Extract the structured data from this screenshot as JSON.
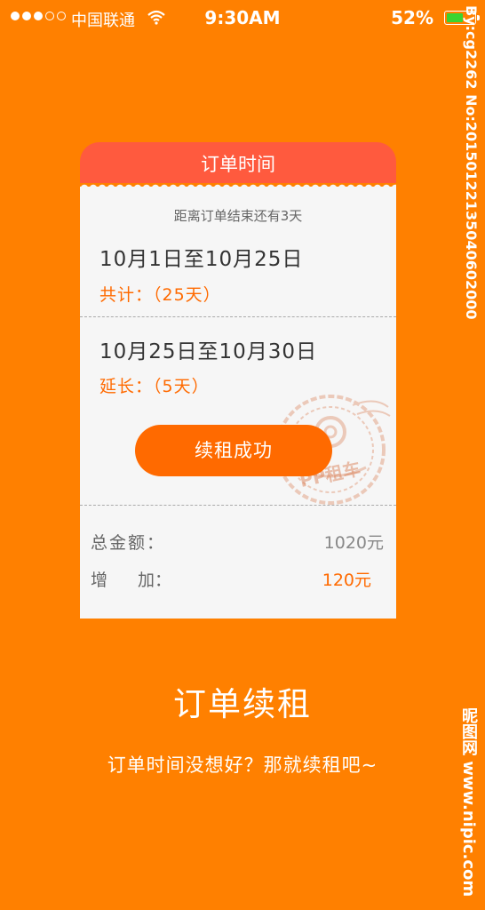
{
  "status_bar": {
    "carrier": "中国联通",
    "time": "9:30AM",
    "battery_percent": "52%",
    "signal_filled": 3,
    "signal_total": 5,
    "battery_level": 0.52
  },
  "card": {
    "header_title": "订单时间",
    "remaining_text": "距离订单结束还有3天",
    "period1": "10月1日至10月25日",
    "total1": "共计：（25天）",
    "period2": "10月25日至10月30日",
    "total2": "延长：（5天）",
    "renew_button": "续租成功",
    "stamp_text": "PP租车",
    "amount_label": "总金额：",
    "amount_value": "1020元",
    "add_label_1": "增",
    "add_label_2": "加：",
    "add_value": "120元"
  },
  "footer": {
    "title": "订单续租",
    "subtitle": "订单时间没想好？那就续租吧~"
  },
  "watermark": {
    "top": "By:cg2262 No:20150122135040602000",
    "bottom": "昵图网 www.nipic.com"
  },
  "colors": {
    "background": "#FF8000",
    "header": "#FF5A3E",
    "accent": "#FF6A00",
    "card": "#F6F6F6",
    "battery": "#39D431"
  }
}
